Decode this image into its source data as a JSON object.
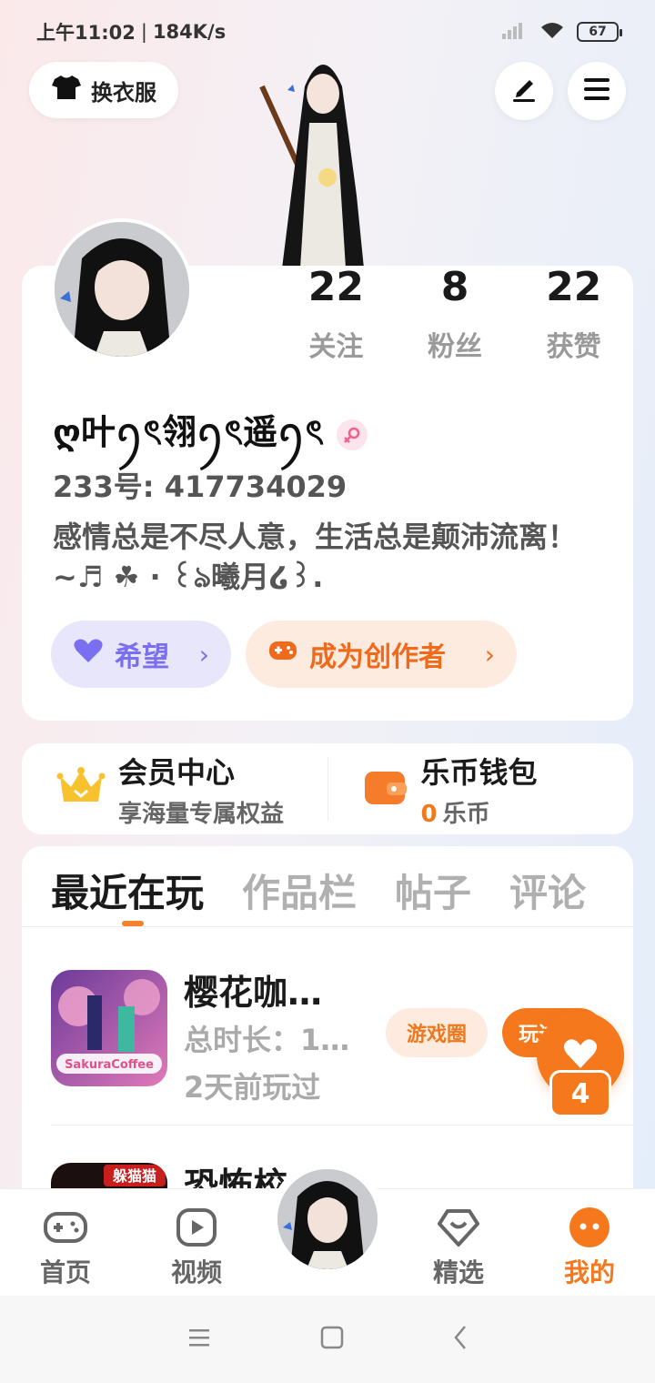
{
  "status": {
    "time": "上午11:02",
    "speed": "184K/s",
    "battery": "67"
  },
  "header": {
    "dress_label": "换衣服"
  },
  "profile": {
    "stats": [
      {
        "num": "22",
        "label": "关注"
      },
      {
        "num": "8",
        "label": "粉丝"
      },
      {
        "num": "22",
        "label": "获赞"
      }
    ],
    "nickname": "ღ叶ꪆৎ翎ꪆৎ遥ꪆৎ",
    "uid": "233号: 417734029",
    "bio": "感情总是不尽人意，生活总是颠沛流离！~♬ ☘ · ꒰ঌ曦月໒꒱.",
    "hope_label": "希望",
    "creator_label": "成为创作者"
  },
  "vip": {
    "member_title": "会员中心",
    "member_sub": "享海量专属权益",
    "wallet_title": "乐币钱包",
    "coin_count": "0",
    "coin_unit": "乐币"
  },
  "tabs": [
    "最近在玩",
    "作品栏",
    "帖子",
    "评论"
  ],
  "games": [
    {
      "title": "樱花咖…",
      "duration": "总时长：1…",
      "last_played": "2天前玩过",
      "circle_btn": "游戏圈",
      "play_btn": "玩过",
      "icon_text": "SakuraCoffee"
    },
    {
      "title": "恐怖校",
      "icon_text": "躲猫猫"
    }
  ],
  "floating": {
    "like_count": "4"
  },
  "nav": [
    "首页",
    "视频",
    "精选",
    "我的"
  ],
  "colors": {
    "accent": "#f5781c",
    "hope": "#7a6ff0"
  }
}
